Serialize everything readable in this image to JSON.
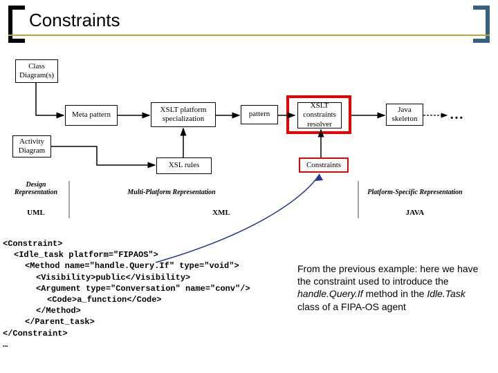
{
  "title": "Constraints",
  "nodes": {
    "class_diagram": "Class\nDiagram(s)",
    "meta_pattern": "Meta pattern",
    "xslt_platform_spec": "XSLT platform\nspecialization",
    "pattern": "pattern",
    "xslt_constraints_resolver": "XSLT\nconstraints\nresolver",
    "java_skeleton": "Java\nskeleton",
    "activity_diagram": "Activity\nDiagram",
    "xsl_rules": "XSL rules",
    "constraints": "Constraints"
  },
  "sections": {
    "design_rep": "Design\nRepresentation",
    "multi_platform_rep": "Multi-Platform Representation",
    "platform_specific_rep": "Platform-Specific Representation",
    "uml": "UML",
    "xml": "XML",
    "java": "JAVA"
  },
  "ellipsis": "…",
  "code": {
    "l1": "<Constraint>",
    "l2": "<Idle_task platform=\"FIPAOS\">",
    "l3": "<Method name=\"handle.Query.If\" type=\"void\">",
    "l4": "<Visibility>public</Visibility>",
    "l5": "<Argument type=\"Conversation\" name=\"conv\"/>",
    "l6": "<Code>a_function</Code>",
    "l7": "</Method>",
    "l8": "</Parent_task>",
    "l9": "</Constraint>",
    "l10": "…"
  },
  "explain": {
    "t1": "From the previous example: here we have the constraint used to introduce the ",
    "t2": "handle.Query.If",
    "t3": " method in the ",
    "t4": "Idle.Task",
    "t5": " class of a FIPA-OS agent"
  }
}
